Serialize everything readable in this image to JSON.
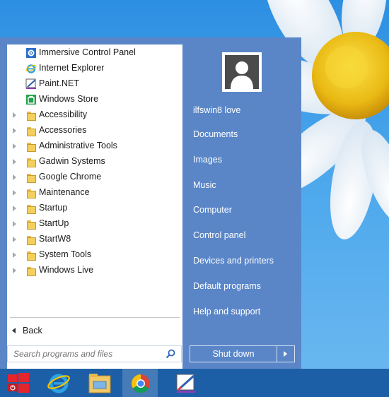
{
  "programs": [
    {
      "label": "Immersive Control Panel",
      "icon": "control-panel-icon",
      "folder": false
    },
    {
      "label": "Internet Explorer",
      "icon": "internet-explorer-icon",
      "folder": false
    },
    {
      "label": "Paint.NET",
      "icon": "paint-net-icon",
      "folder": false
    },
    {
      "label": "Windows Store",
      "icon": "windows-store-icon",
      "folder": false
    },
    {
      "label": "Accessibility",
      "icon": "folder-icon",
      "folder": true
    },
    {
      "label": "Accessories",
      "icon": "folder-icon",
      "folder": true
    },
    {
      "label": "Administrative Tools",
      "icon": "folder-icon",
      "folder": true
    },
    {
      "label": "Gadwin Systems",
      "icon": "folder-icon",
      "folder": true
    },
    {
      "label": "Google Chrome",
      "icon": "folder-icon",
      "folder": true
    },
    {
      "label": "Maintenance",
      "icon": "folder-icon",
      "folder": true
    },
    {
      "label": "Startup",
      "icon": "folder-icon",
      "folder": true
    },
    {
      "label": "StartUp",
      "icon": "folder-icon",
      "folder": true
    },
    {
      "label": "StartW8",
      "icon": "folder-icon",
      "folder": true
    },
    {
      "label": "System Tools",
      "icon": "folder-icon",
      "folder": true
    },
    {
      "label": "Windows Live",
      "icon": "folder-icon",
      "folder": true
    }
  ],
  "back_label": "Back",
  "search": {
    "placeholder": "Search programs and files"
  },
  "user": {
    "name": "ilfswin8 love"
  },
  "right_links": [
    "Documents",
    "Images",
    "Music",
    "Computer",
    "Control panel",
    "Devices and printers",
    "Default programs",
    "Help and support"
  ],
  "shutdown_label": "Shut down",
  "taskbar": [
    {
      "name": "start-button",
      "icon": "start-icon"
    },
    {
      "name": "internet-explorer-taskbar",
      "icon": "internet-explorer-icon"
    },
    {
      "name": "file-explorer-taskbar",
      "icon": "file-explorer-icon"
    },
    {
      "name": "chrome-taskbar",
      "icon": "chrome-icon",
      "active": true
    },
    {
      "name": "paint-net-taskbar",
      "icon": "paint-net-icon"
    }
  ],
  "colors": {
    "menu_bg": "#5a86c8",
    "taskbar_bg": "#1d5fa6",
    "wallpaper_sky": "#2d8fe2",
    "flower_center": "#f2c21a"
  }
}
